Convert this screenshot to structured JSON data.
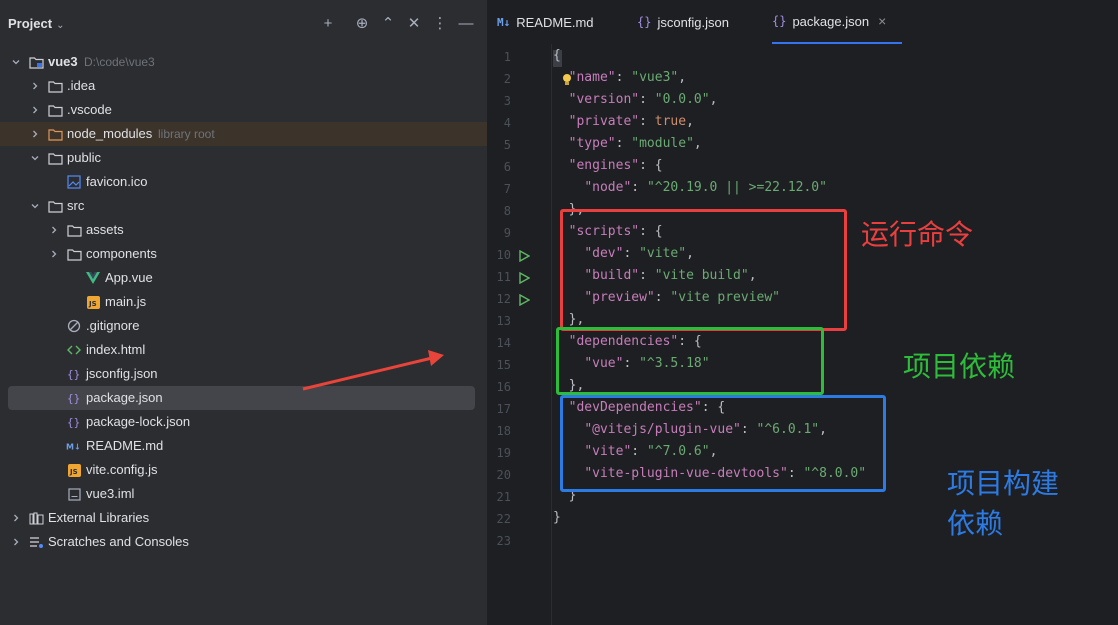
{
  "project_panel": {
    "title": "Project",
    "tree": [
      {
        "label": "vue3",
        "extra": "D:\\code\\vue3",
        "kind": "module",
        "arrow": "down",
        "depth": 0
      },
      {
        "label": ".idea",
        "kind": "folder",
        "arrow": "right",
        "depth": 1
      },
      {
        "label": ".vscode",
        "kind": "folder",
        "arrow": "right",
        "depth": 1
      },
      {
        "label": "node_modules",
        "extra": "library root",
        "kind": "folder-orange",
        "arrow": "right",
        "depth": 1,
        "highlight": true
      },
      {
        "label": "public",
        "kind": "folder",
        "arrow": "down",
        "depth": 1
      },
      {
        "label": "favicon.ico",
        "kind": "image",
        "depth": 2
      },
      {
        "label": "src",
        "kind": "folder",
        "arrow": "down",
        "depth": 1
      },
      {
        "label": "assets",
        "kind": "folder",
        "arrow": "right",
        "depth": 2
      },
      {
        "label": "components",
        "kind": "folder",
        "arrow": "right",
        "depth": 2
      },
      {
        "label": "App.vue",
        "kind": "vue",
        "depth": 3
      },
      {
        "label": "main.js",
        "kind": "js",
        "depth": 3
      },
      {
        "label": ".gitignore",
        "kind": "ignore",
        "depth": 2
      },
      {
        "label": "index.html",
        "kind": "html",
        "depth": 2
      },
      {
        "label": "jsconfig.json",
        "kind": "json",
        "depth": 2
      },
      {
        "label": "package.json",
        "kind": "json",
        "depth": 2,
        "selected": true
      },
      {
        "label": "package-lock.json",
        "kind": "json",
        "depth": 2
      },
      {
        "label": "README.md",
        "kind": "md",
        "depth": 2
      },
      {
        "label": "vite.config.js",
        "kind": "js",
        "depth": 2
      },
      {
        "label": "vue3.iml",
        "kind": "iml",
        "depth": 2
      },
      {
        "label": "External Libraries",
        "kind": "libs",
        "arrow": "right",
        "depth": 0
      },
      {
        "label": "Scratches and Consoles",
        "kind": "scratch",
        "arrow": "right",
        "depth": 0
      }
    ]
  },
  "tabs": [
    {
      "label": "README.md",
      "icon": "markdown-icon",
      "active": false
    },
    {
      "label": "jsconfig.json",
      "icon": "json-icon",
      "active": false
    },
    {
      "label": "package.json",
      "icon": "json-icon",
      "active": true,
      "close": "×"
    }
  ],
  "code_lines": [
    [
      [
        "p",
        "{"
      ]
    ],
    [
      [
        "p",
        "  "
      ],
      [
        "k",
        "\"name\""
      ],
      [
        "p",
        ": "
      ],
      [
        "s",
        "\"vue3\""
      ],
      [
        "p",
        ","
      ]
    ],
    [
      [
        "p",
        "  "
      ],
      [
        "k",
        "\"version\""
      ],
      [
        "p",
        ": "
      ],
      [
        "s",
        "\"0.0.0\""
      ],
      [
        "p",
        ","
      ]
    ],
    [
      [
        "p",
        "  "
      ],
      [
        "k",
        "\"private\""
      ],
      [
        "p",
        ": "
      ],
      [
        "kw",
        "true"
      ],
      [
        "p",
        ","
      ]
    ],
    [
      [
        "p",
        "  "
      ],
      [
        "k",
        "\"type\""
      ],
      [
        "p",
        ": "
      ],
      [
        "s",
        "\"module\""
      ],
      [
        "p",
        ","
      ]
    ],
    [
      [
        "p",
        "  "
      ],
      [
        "k",
        "\"engines\""
      ],
      [
        "p",
        ": {"
      ]
    ],
    [
      [
        "p",
        "    "
      ],
      [
        "k",
        "\"node\""
      ],
      [
        "p",
        ": "
      ],
      [
        "s",
        "\"^20.19.0 || >=22.12.0\""
      ]
    ],
    [
      [
        "p",
        "  },"
      ]
    ],
    [
      [
        "p",
        "  "
      ],
      [
        "k",
        "\"scripts\""
      ],
      [
        "p",
        ": {"
      ]
    ],
    [
      [
        "p",
        "    "
      ],
      [
        "k",
        "\"dev\""
      ],
      [
        "p",
        ": "
      ],
      [
        "s",
        "\"vite\""
      ],
      [
        "p",
        ","
      ]
    ],
    [
      [
        "p",
        "    "
      ],
      [
        "k",
        "\"build\""
      ],
      [
        "p",
        ": "
      ],
      [
        "s",
        "\"vite build\""
      ],
      [
        "p",
        ","
      ]
    ],
    [
      [
        "p",
        "    "
      ],
      [
        "k",
        "\"preview\""
      ],
      [
        "p",
        ": "
      ],
      [
        "s",
        "\"vite preview\""
      ]
    ],
    [
      [
        "p",
        "  },"
      ]
    ],
    [
      [
        "p",
        "  "
      ],
      [
        "k",
        "\"dependencies\""
      ],
      [
        "p",
        ": {"
      ]
    ],
    [
      [
        "p",
        "    "
      ],
      [
        "k",
        "\"vue\""
      ],
      [
        "p",
        ": "
      ],
      [
        "s",
        "\"^3.5.18\""
      ]
    ],
    [
      [
        "p",
        "  },"
      ]
    ],
    [
      [
        "p",
        "  "
      ],
      [
        "k",
        "\"devDependencies\""
      ],
      [
        "p",
        ": {"
      ]
    ],
    [
      [
        "p",
        "    "
      ],
      [
        "k",
        "\"@vitejs/plugin-vue\""
      ],
      [
        "p",
        ": "
      ],
      [
        "s",
        "\"^6.0.1\""
      ],
      [
        "p",
        ","
      ]
    ],
    [
      [
        "p",
        "    "
      ],
      [
        "k",
        "\"vite\""
      ],
      [
        "p",
        ": "
      ],
      [
        "s",
        "\"^7.0.6\""
      ],
      [
        "p",
        ","
      ]
    ],
    [
      [
        "p",
        "    "
      ],
      [
        "k",
        "\"vite-plugin-vue-devtools\""
      ],
      [
        "p",
        ": "
      ],
      [
        "s",
        "\"^8.0.0\""
      ]
    ],
    [
      [
        "p",
        "  }"
      ]
    ],
    [
      [
        "p",
        "}"
      ]
    ],
    [
      [
        "p",
        ""
      ]
    ]
  ],
  "run_lines": [
    10,
    11,
    12
  ],
  "annotations": {
    "scripts": {
      "text": "运行命令",
      "color": "#ea3f3f"
    },
    "dependencies": {
      "text": "项目依赖",
      "color": "#2ebd3a"
    },
    "dev_dependencies": {
      "line1": "项目构建",
      "line2": "依赖",
      "color": "#2c7be5"
    },
    "arrow_color": "#e8443a"
  },
  "colors": {
    "accent": "#3574f0",
    "selection": "#43454a"
  }
}
